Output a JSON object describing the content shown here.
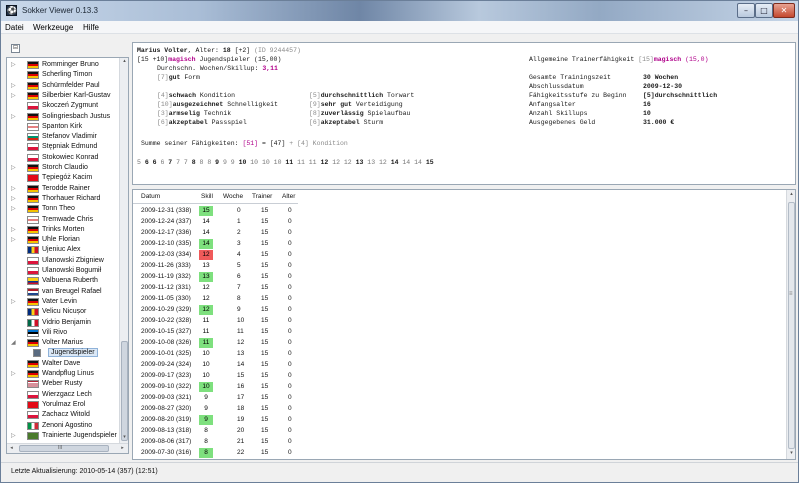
{
  "window": {
    "title": "Sokker Viewer 0.13.3",
    "app_icon_glyph": "⚽",
    "controls": {
      "minimize": "–",
      "maximize": "□",
      "close": "✕"
    }
  },
  "menu": [
    "Datei",
    "Werkzeuge",
    "Hilfe"
  ],
  "tree": {
    "toolbar_icon": "⊟",
    "items": [
      {
        "label": "Romminger Bruno",
        "flag": "de",
        "expand": "▷"
      },
      {
        "label": "Scherling Timon",
        "flag": "de",
        "expand": ""
      },
      {
        "label": "Schürmfelder Paul",
        "flag": "de",
        "expand": "▷"
      },
      {
        "label": "Silberbier Karl-Gustav",
        "flag": "de",
        "expand": "▷"
      },
      {
        "label": "Skoczeń Zygmunt",
        "flag": "pl",
        "expand": ""
      },
      {
        "label": "Solingriesbach Justus",
        "flag": "de",
        "expand": "▷"
      },
      {
        "label": "Spanton Kirk",
        "flag": "en",
        "expand": ""
      },
      {
        "label": "Stefanov Vladimir",
        "flag": "bg",
        "expand": ""
      },
      {
        "label": "Stępniak Edmund",
        "flag": "pl",
        "expand": ""
      },
      {
        "label": "Stokowiec Konrad",
        "flag": "pl",
        "expand": ""
      },
      {
        "label": "Storch Claudio",
        "flag": "de",
        "expand": "▷"
      },
      {
        "label": "Tępiegóż Kacim",
        "flag": "tr",
        "expand": ""
      },
      {
        "label": "Terodde Rainer",
        "flag": "de",
        "expand": "▷"
      },
      {
        "label": "Thorhauer Richard",
        "flag": "de",
        "expand": "▷"
      },
      {
        "label": "Tonn Theo",
        "flag": "de",
        "expand": "▷"
      },
      {
        "label": "Tremwade Chris",
        "flag": "en",
        "expand": ""
      },
      {
        "label": "Trinks Morten",
        "flag": "de",
        "expand": "▷"
      },
      {
        "label": "Uhle Florian",
        "flag": "de",
        "expand": "▷"
      },
      {
        "label": "Ujeniuc Alex",
        "flag": "ro",
        "expand": ""
      },
      {
        "label": "Ulanowski Zbigniew",
        "flag": "pl",
        "expand": ""
      },
      {
        "label": "Ulanowski Bogumił",
        "flag": "pl",
        "expand": ""
      },
      {
        "label": "Valbuena Ruberth",
        "flag": "co",
        "expand": ""
      },
      {
        "label": "van Breugel Rafael",
        "flag": "nl",
        "expand": ""
      },
      {
        "label": "Vater Levin",
        "flag": "de",
        "expand": "▷"
      },
      {
        "label": "Velicu Nicușor",
        "flag": "ro",
        "expand": ""
      },
      {
        "label": "Vidrio Benjamin",
        "flag": "mx",
        "expand": ""
      },
      {
        "label": "Vili Rivo",
        "flag": "ee",
        "expand": ""
      },
      {
        "label": "Volter Marius",
        "flag": "de",
        "expand": "◢"
      },
      {
        "label": "Jugendspieler",
        "flag": "",
        "expand": "",
        "child": true,
        "selected": true
      },
      {
        "label": "Walter Dave",
        "flag": "de",
        "expand": ""
      },
      {
        "label": "Wandpflug Linus",
        "flag": "de",
        "expand": "▷"
      },
      {
        "label": "Weber Rusty",
        "flag": "us",
        "expand": ""
      },
      {
        "label": "Wierzgacz Lech",
        "flag": "pl",
        "expand": ""
      },
      {
        "label": "Yorulmaz Erol",
        "flag": "tr",
        "expand": ""
      },
      {
        "label": "Zachacz Witold",
        "flag": "pl",
        "expand": ""
      },
      {
        "label": "Zenoni Agostino",
        "flag": "it",
        "expand": ""
      },
      {
        "label": "Trainierte Jugendspieler",
        "flag": "grp",
        "expand": "▷"
      }
    ],
    "scroll_arrows": {
      "left": "◂",
      "right": "▸",
      "up": "▴",
      "down": "▾"
    },
    "hscroll_mid": "III"
  },
  "player": {
    "name_line": "Marius Volter",
    "alter_label": ", Alter:",
    "alter_value": "18",
    "alter_extra": "[+2]",
    "id_text": "(ID 9244457)",
    "line2_bracket": "[15 +10]",
    "line2_level": "magisch",
    "line2_rest": "Jugendspieler (15,00)",
    "line3": "Durchschn. Wochen/Skillup:",
    "line3_value": "3,11",
    "form_num": "[7]",
    "form_level": "gut",
    "form_label": "Form",
    "skills_left": [
      {
        "num": "[4]",
        "level": "schwach",
        "label": "Kondition"
      },
      {
        "num": "[10]",
        "level": "ausgezeichnet",
        "label": "Schnelligkeit"
      },
      {
        "num": "[3]",
        "level": "armselig",
        "label": "Technik"
      },
      {
        "num": "[6]",
        "level": "akzeptabel",
        "label": "Passspiel"
      }
    ],
    "skills_right": [
      {
        "num": "[5]",
        "level": "durchschnittlich",
        "label": "Torwart"
      },
      {
        "num": "[9]",
        "level": "sehr gut",
        "label": "Verteidigung"
      },
      {
        "num": "[8]",
        "level": "zuverlässig",
        "label": "Spielaufbau"
      },
      {
        "num": "[6]",
        "level": "akzeptabel",
        "label": "Sturm"
      }
    ],
    "summe_label": "Summe seiner Fähigkeiten:",
    "summe_value": "[51]",
    "summe_eq": "= [47]",
    "summe_extra": "+ [4] Kondition",
    "skill_sequence": [
      {
        "v": "5",
        "b": false
      },
      {
        "v": "6",
        "b": true
      },
      {
        "v": "6",
        "b": true
      },
      {
        "v": "6",
        "b": false
      },
      {
        "v": "7",
        "b": true
      },
      {
        "v": "7",
        "b": false
      },
      {
        "v": "7",
        "b": false
      },
      {
        "v": "8",
        "b": true
      },
      {
        "v": "8",
        "b": false
      },
      {
        "v": "8",
        "b": false
      },
      {
        "v": "9",
        "b": true
      },
      {
        "v": "9",
        "b": false
      },
      {
        "v": "9",
        "b": false
      },
      {
        "v": "10",
        "b": true
      },
      {
        "v": "10",
        "b": false
      },
      {
        "v": "10",
        "b": false
      },
      {
        "v": "10",
        "b": false
      },
      {
        "v": "11",
        "b": true
      },
      {
        "v": "11",
        "b": false
      },
      {
        "v": "11",
        "b": false
      },
      {
        "v": "12",
        "b": true
      },
      {
        "v": "12",
        "b": false
      },
      {
        "v": "12",
        "b": false
      },
      {
        "v": "13",
        "b": true
      },
      {
        "v": "13",
        "b": false
      },
      {
        "v": "12",
        "b": false
      },
      {
        "v": "14",
        "b": true
      },
      {
        "v": "14",
        "b": false
      },
      {
        "v": "14",
        "b": false
      },
      {
        "v": "15",
        "b": true
      }
    ]
  },
  "trainer": {
    "heading": "Allgemeine Trainerfähigkeit",
    "heading_num": "[15]",
    "heading_level": "magisch",
    "heading_value": "(15,0)",
    "rows": [
      {
        "label": "Gesamte Trainingszeit",
        "value": "30 Wochen"
      },
      {
        "label": "Abschlussdatum",
        "value": "2009-12-30"
      },
      {
        "label": "Fähigkeitsstufe zu Beginn",
        "value": "[5]durchschnittlich"
      },
      {
        "label": "Anfangsalter",
        "value": "16"
      },
      {
        "label": "Anzahl Skillups",
        "value": "10"
      },
      {
        "label": "Ausgegebenes Geld",
        "value": "31.000 €"
      }
    ]
  },
  "table": {
    "headers": [
      "Datum",
      "Skill",
      "Woche",
      "Trainer",
      "Alter"
    ],
    "rows": [
      {
        "datum": "2009-12-31 (338)",
        "skill": "15",
        "woche": "0",
        "trainer": "15",
        "alter": "0",
        "hl": "green"
      },
      {
        "datum": "2009-12-24 (337)",
        "skill": "14",
        "woche": "1",
        "trainer": "15",
        "alter": "0",
        "hl": ""
      },
      {
        "datum": "2009-12-17 (336)",
        "skill": "14",
        "woche": "2",
        "trainer": "15",
        "alter": "0",
        "hl": ""
      },
      {
        "datum": "2009-12-10 (335)",
        "skill": "14",
        "woche": "3",
        "trainer": "15",
        "alter": "0",
        "hl": "green"
      },
      {
        "datum": "2009-12-03 (334)",
        "skill": "12",
        "woche": "4",
        "trainer": "15",
        "alter": "0",
        "hl": "red"
      },
      {
        "datum": "2009-11-26 (333)",
        "skill": "13",
        "woche": "5",
        "trainer": "15",
        "alter": "0",
        "hl": ""
      },
      {
        "datum": "2009-11-19 (332)",
        "skill": "13",
        "woche": "6",
        "trainer": "15",
        "alter": "0",
        "hl": "green"
      },
      {
        "datum": "2009-11-12 (331)",
        "skill": "12",
        "woche": "7",
        "trainer": "15",
        "alter": "0",
        "hl": ""
      },
      {
        "datum": "2009-11-05 (330)",
        "skill": "12",
        "woche": "8",
        "trainer": "15",
        "alter": "0",
        "hl": ""
      },
      {
        "datum": "2009-10-29 (329)",
        "skill": "12",
        "woche": "9",
        "trainer": "15",
        "alter": "0",
        "hl": "green"
      },
      {
        "datum": "2009-10-22 (328)",
        "skill": "11",
        "woche": "10",
        "trainer": "15",
        "alter": "0",
        "hl": ""
      },
      {
        "datum": "2009-10-15 (327)",
        "skill": "11",
        "woche": "11",
        "trainer": "15",
        "alter": "0",
        "hl": ""
      },
      {
        "datum": "2009-10-08 (326)",
        "skill": "11",
        "woche": "12",
        "trainer": "15",
        "alter": "0",
        "hl": "green"
      },
      {
        "datum": "2009-10-01 (325)",
        "skill": "10",
        "woche": "13",
        "trainer": "15",
        "alter": "0",
        "hl": ""
      },
      {
        "datum": "2009-09-24 (324)",
        "skill": "10",
        "woche": "14",
        "trainer": "15",
        "alter": "0",
        "hl": ""
      },
      {
        "datum": "2009-09-17 (323)",
        "skill": "10",
        "woche": "15",
        "trainer": "15",
        "alter": "0",
        "hl": ""
      },
      {
        "datum": "2009-09-10 (322)",
        "skill": "10",
        "woche": "16",
        "trainer": "15",
        "alter": "0",
        "hl": "green"
      },
      {
        "datum": "2009-09-03 (321)",
        "skill": "9",
        "woche": "17",
        "trainer": "15",
        "alter": "0",
        "hl": ""
      },
      {
        "datum": "2009-08-27 (320)",
        "skill": "9",
        "woche": "18",
        "trainer": "15",
        "alter": "0",
        "hl": ""
      },
      {
        "datum": "2009-08-20 (319)",
        "skill": "9",
        "woche": "19",
        "trainer": "15",
        "alter": "0",
        "hl": "green"
      },
      {
        "datum": "2009-08-13 (318)",
        "skill": "8",
        "woche": "20",
        "trainer": "15",
        "alter": "0",
        "hl": ""
      },
      {
        "datum": "2009-08-06 (317)",
        "skill": "8",
        "woche": "21",
        "trainer": "15",
        "alter": "0",
        "hl": ""
      },
      {
        "datum": "2009-07-30 (316)",
        "skill": "8",
        "woche": "22",
        "trainer": "15",
        "alter": "0",
        "hl": "green"
      }
    ],
    "colors": {
      "green": "#7ee07e",
      "red": "#f05a5a"
    },
    "scroll_arrows": {
      "up": "▴",
      "down": "▾",
      "grip": "≡"
    }
  },
  "status": "Letzte Aktualisierung: 2010-05-14 (357) (12:51)"
}
